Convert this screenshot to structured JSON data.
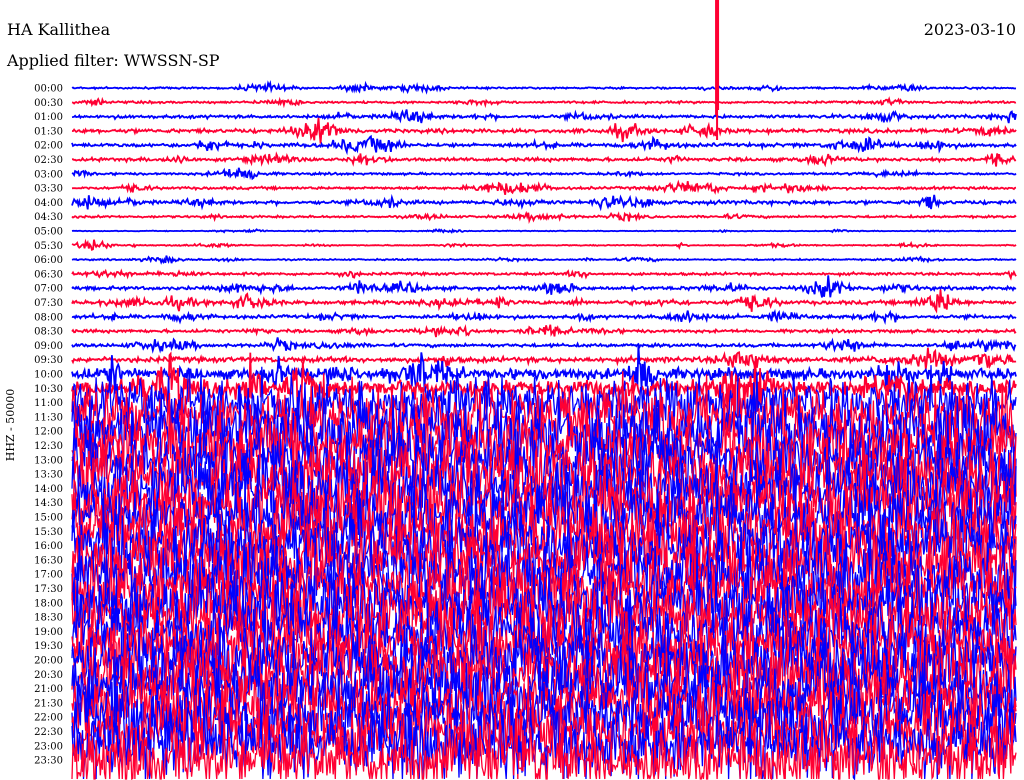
{
  "header": {
    "station": "HA Kallithea",
    "filter": "Applied filter: WWSSN-SP",
    "date": "2023-03-10"
  },
  "chart_data": {
    "type": "line",
    "title": "HA Kallithea",
    "subtitle": "Applied filter: WWSSN-SP",
    "date": "2023-03-10",
    "ylabel": "HHZ - 50000",
    "xlabel": "",
    "row_labels": [
      "00:00",
      "00:30",
      "01:00",
      "01:30",
      "02:00",
      "02:30",
      "03:00",
      "03:30",
      "04:00",
      "04:30",
      "05:00",
      "05:30",
      "06:00",
      "06:30",
      "07:00",
      "07:30",
      "08:00",
      "08:30",
      "09:00",
      "09:30",
      "10:00",
      "10:30",
      "11:00",
      "11:30",
      "12:00",
      "12:30",
      "13:00",
      "13:30",
      "14:00",
      "14:30",
      "15:00",
      "15:30",
      "16:00",
      "16:30",
      "17:00",
      "17:30",
      "18:00",
      "18:30",
      "19:00",
      "19:30",
      "20:00",
      "20:30",
      "21:00",
      "21:30",
      "22:00",
      "22:30",
      "23:00",
      "23:30"
    ],
    "series_colors": [
      "#0000ff",
      "#ff0033"
    ],
    "activity_levels": [
      0.25,
      0.3,
      0.45,
      0.55,
      0.5,
      0.45,
      0.3,
      0.35,
      0.5,
      0.3,
      0.1,
      0.15,
      0.2,
      0.35,
      0.45,
      0.5,
      0.45,
      0.4,
      0.45,
      0.7,
      1.5,
      2.5,
      3.5,
      4.5,
      5,
      5,
      5,
      5,
      5,
      5,
      5,
      5,
      5,
      5,
      5,
      5,
      5,
      5,
      5,
      5,
      5,
      5,
      5,
      5,
      5,
      5,
      5,
      5
    ],
    "events": [
      {
        "time": "00:00",
        "offset_min": 20.5,
        "amplitude": "off-scale"
      }
    ],
    "grid": false,
    "legend": "none"
  }
}
